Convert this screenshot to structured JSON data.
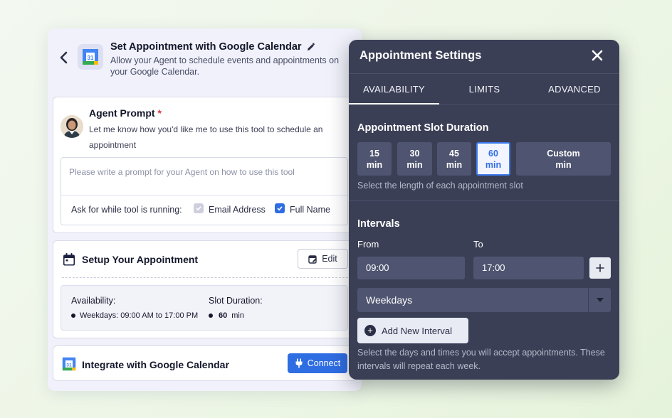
{
  "left": {
    "title": "Set Appointment with Google Calendar",
    "description": "Allow your Agent to schedule events and appointments on your Google Calendar.",
    "gcal_badge": "31",
    "agent_prompt": {
      "title": "Agent Prompt",
      "required_mark": "*",
      "text": "Let me know how you'd like me to use this tool to schedule an appointment",
      "placeholder": "Please write a prompt for your Agent on how to use this tool",
      "ask_label": "Ask for while tool is running:",
      "options": [
        {
          "label": "Email Address",
          "checked": true,
          "disabled": true
        },
        {
          "label": "Full Name",
          "checked": true,
          "disabled": false
        }
      ]
    },
    "setup": {
      "title": "Setup Your Appointment",
      "edit_label": "Edit",
      "availability_label": "Availability:",
      "availability_value": "Weekdays: 09:00 AM to 17:00 PM",
      "slot_label": "Slot Duration:",
      "slot_value": "60",
      "slot_unit": "min"
    },
    "integrate": {
      "title": "Integrate with Google Calendar",
      "connect_label": "Connect"
    }
  },
  "settings": {
    "title": "Appointment Settings",
    "tabs": [
      {
        "label": "AVAILABILITY",
        "active": true
      },
      {
        "label": "LIMITS",
        "active": false
      },
      {
        "label": "ADVANCED",
        "active": false
      }
    ],
    "slot_section": {
      "title": "Appointment Slot Duration",
      "slots": [
        {
          "value": "15",
          "unit": "min",
          "selected": false
        },
        {
          "value": "30",
          "unit": "min",
          "selected": false
        },
        {
          "value": "45",
          "unit": "min",
          "selected": false
        },
        {
          "value": "60",
          "unit": "min",
          "selected": true
        },
        {
          "value": "Custom",
          "unit": "min",
          "selected": false
        }
      ],
      "hint": "Select the length of each appointment slot"
    },
    "intervals": {
      "title": "Intervals",
      "from_label": "From",
      "to_label": "To",
      "from_value": "09:00",
      "to_value": "17:00",
      "days_value": "Weekdays",
      "add_label": "Add New Interval",
      "hint": "Select the days and times you will accept appointments. These intervals will repeat each week."
    }
  },
  "colors": {
    "accent": "#2f6de3",
    "dark_panel": "#3b3f56",
    "required": "#e0373f"
  }
}
